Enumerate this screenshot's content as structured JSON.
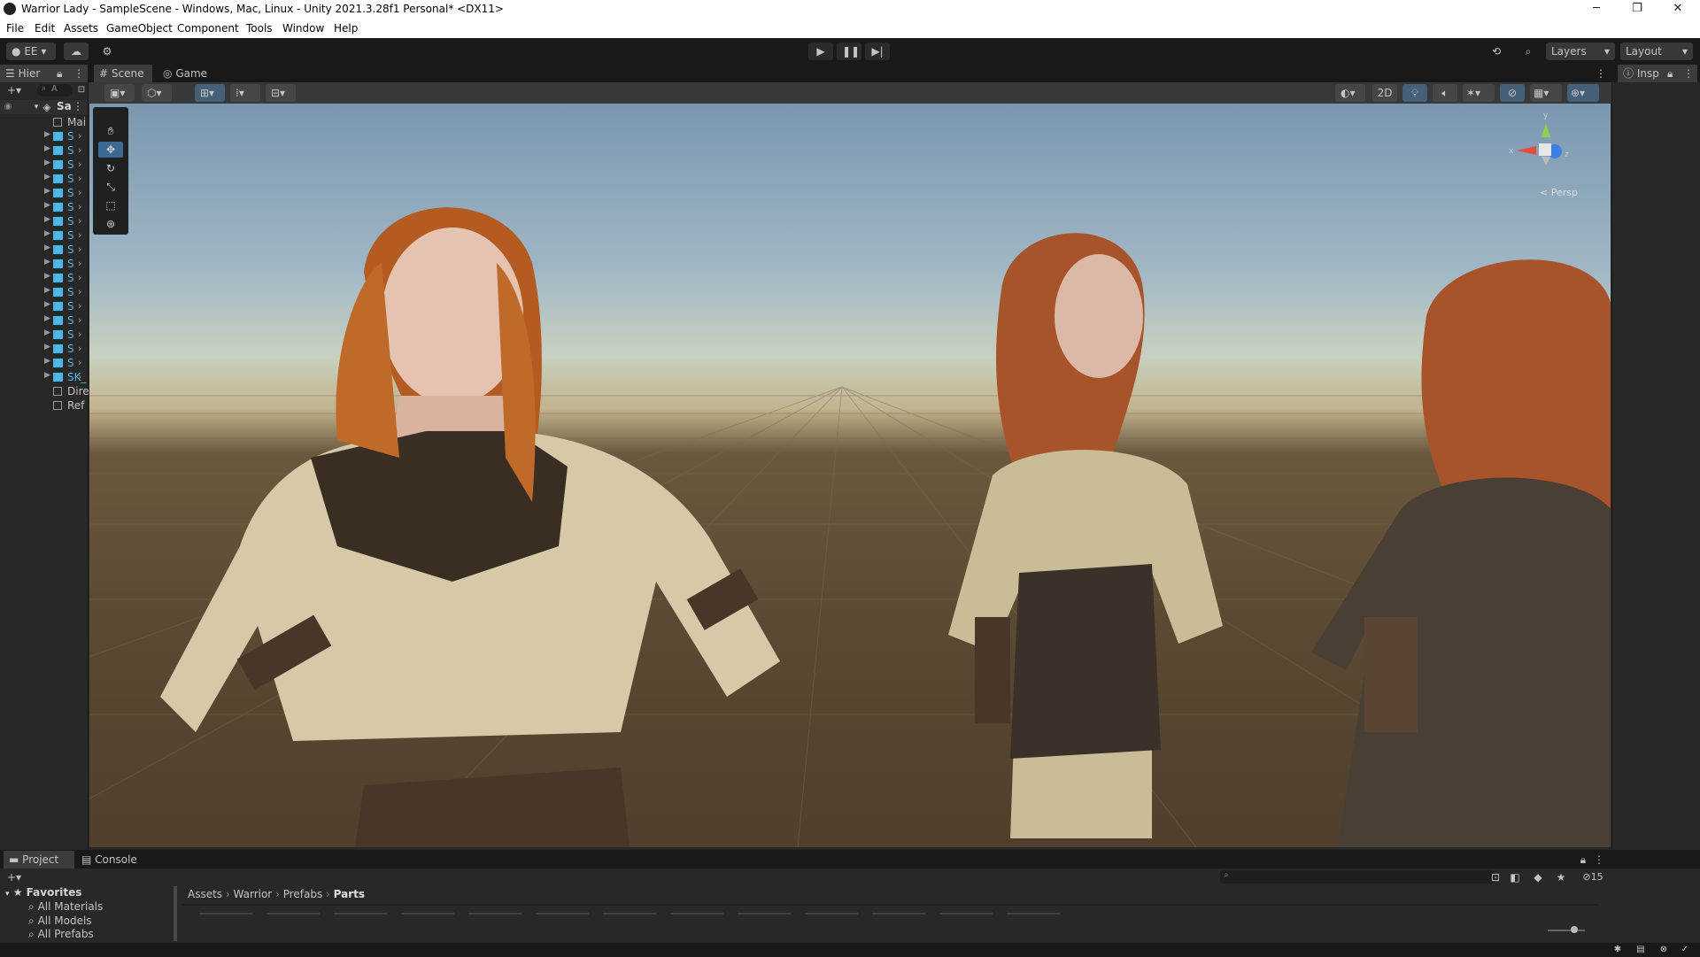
{
  "window": {
    "title": "Warrior Lady - SampleScene - Windows, Mac, Linux - Unity 2021.3.28f1 Personal* <DX11>",
    "controls": [
      "─",
      "❐",
      "✕"
    ]
  },
  "menu": [
    "File",
    "Edit",
    "Assets",
    "GameObject",
    "Component",
    "Tools",
    "Window",
    "Help"
  ],
  "toolbar": {
    "account": "EE",
    "layers_label": "Layers",
    "layout_label": "Layout"
  },
  "hierarchy": {
    "tab": "Hier",
    "search_placeholder": "A",
    "scene_root": "Sa",
    "items": [
      {
        "label": "Mai",
        "type": "object"
      },
      {
        "label": "S",
        "type": "prefab"
      },
      {
        "label": "S",
        "type": "prefab"
      },
      {
        "label": "S",
        "type": "prefab"
      },
      {
        "label": "S",
        "type": "prefab"
      },
      {
        "label": "S",
        "type": "prefab"
      },
      {
        "label": "S",
        "type": "prefab"
      },
      {
        "label": "S",
        "type": "prefab"
      },
      {
        "label": "S",
        "type": "prefab"
      },
      {
        "label": "S",
        "type": "prefab"
      },
      {
        "label": "S",
        "type": "prefab"
      },
      {
        "label": "S",
        "type": "prefab"
      },
      {
        "label": "S",
        "type": "prefab"
      },
      {
        "label": "S",
        "type": "prefab"
      },
      {
        "label": "S",
        "type": "prefab"
      },
      {
        "label": "S",
        "type": "prefab"
      },
      {
        "label": "S",
        "type": "prefab"
      },
      {
        "label": "S",
        "type": "prefab"
      },
      {
        "label": "SK_",
        "type": "prefab-selected"
      },
      {
        "label": "Dire",
        "type": "object"
      },
      {
        "label": "Ref",
        "type": "object"
      }
    ]
  },
  "scene_tabs": [
    "Scene",
    "Game"
  ],
  "scene_toolbar": {
    "mode_2d": "2D"
  },
  "gizmo": {
    "y_label": "y",
    "x_label": "x",
    "z_label": "z",
    "projection": "< Persp"
  },
  "inspector": {
    "tab": "Insp"
  },
  "project": {
    "tabs": [
      "Project",
      "Console"
    ],
    "favorites_title": "Favorites",
    "favorites": [
      "All Materials",
      "All Models",
      "All Prefabs"
    ],
    "breadcrumb": [
      "Assets",
      "Warrior",
      "Prefabs",
      "Parts"
    ],
    "hidden_count": "15"
  },
  "colors": {
    "accent_blue": "#4db6e9",
    "selected_tool": "#3d6a93",
    "editor_bg": "#282828"
  }
}
